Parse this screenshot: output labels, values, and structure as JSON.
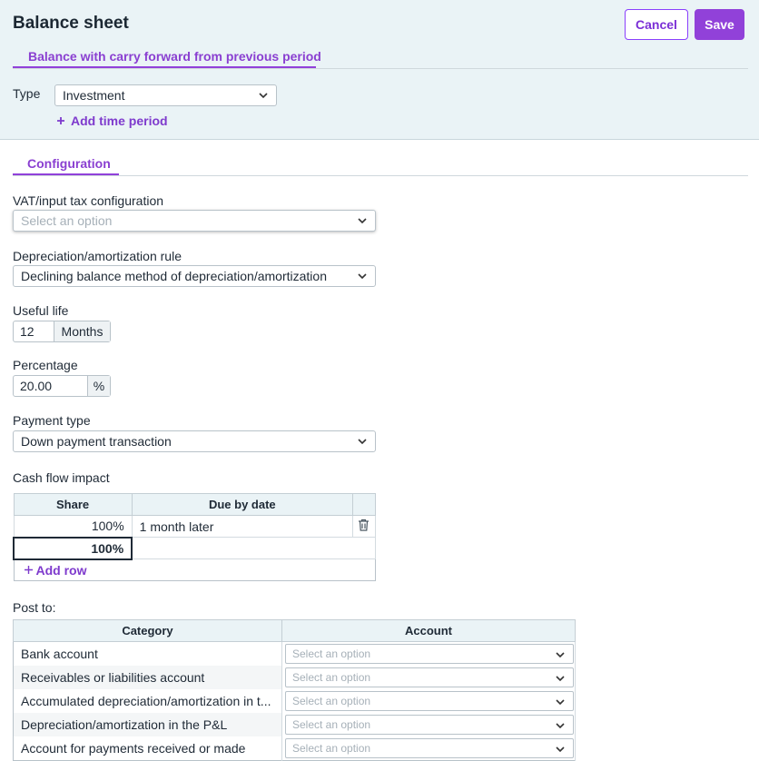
{
  "header": {
    "title": "Balance sheet",
    "cancel_label": "Cancel",
    "save_label": "Save",
    "tab_label": "Balance with carry forward from previous period",
    "type_label": "Type",
    "type_value": "Investment",
    "add_time_period_label": "Add time period"
  },
  "config": {
    "tab_label": "Configuration",
    "vat_label": "VAT/input tax configuration",
    "vat_placeholder": "Select an option",
    "depreciation_label": "Depreciation/amortization rule",
    "depreciation_value": "Declining balance method of depreciation/amortization",
    "useful_life_label": "Useful life",
    "useful_life_value": "12",
    "useful_life_unit": "Months",
    "percentage_label": "Percentage",
    "percentage_value": "20.00",
    "percentage_unit": "%",
    "payment_type_label": "Payment type",
    "payment_type_value": "Down payment transaction",
    "cash_flow_label": "Cash flow impact",
    "cash_flow_table": {
      "headers": [
        "Share",
        "Due by date"
      ],
      "rows": [
        {
          "share": "100%",
          "due": "1 month later"
        }
      ],
      "total": "100%",
      "add_row_label": "Add row"
    },
    "post_to_label": "Post to:",
    "post_to_table": {
      "headers": [
        "Category",
        "Account"
      ],
      "rows": [
        {
          "category": "Bank account",
          "account_placeholder": "Select an option"
        },
        {
          "category": "Receivables or liabilities account",
          "account_placeholder": "Select an option"
        },
        {
          "category": "Accumulated depreciation/amortization in t...",
          "account_placeholder": "Select an option"
        },
        {
          "category": "Depreciation/amortization in the P&L",
          "account_placeholder": "Select an option"
        },
        {
          "category": "Account for payments received or made",
          "account_placeholder": "Select an option"
        }
      ]
    }
  },
  "colors": {
    "accent": "#9141d9",
    "header_bg": "#eaf3f6"
  },
  "icons": [
    "chevron-down-icon",
    "plus-icon",
    "trash-icon"
  ]
}
